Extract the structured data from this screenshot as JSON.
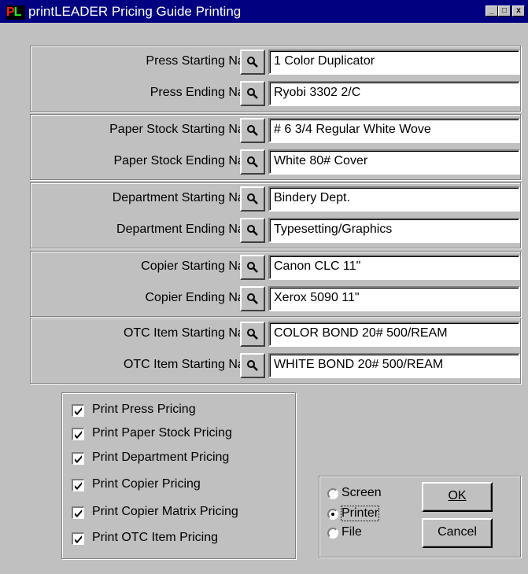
{
  "window": {
    "title": "printLEADER Pricing Guide Printing",
    "logo_text_p": "P",
    "logo_text_l": "L",
    "minimize_glyph": "_",
    "maximize_glyph": "□",
    "close_glyph": "x"
  },
  "groups": [
    {
      "rows": [
        {
          "label": "Press Starting Name",
          "value": "1 Color Duplicator"
        },
        {
          "label": "Press Ending Name",
          "value": "Ryobi 3302 2/C"
        }
      ]
    },
    {
      "rows": [
        {
          "label": "Paper Stock Starting Name",
          "value": "# 6 3/4 Regular White Wove"
        },
        {
          "label": "Paper Stock Ending Name",
          "value": "White 80# Cover"
        }
      ]
    },
    {
      "rows": [
        {
          "label": "Department Starting Name",
          "value": "Bindery Dept."
        },
        {
          "label": "Department Ending Name",
          "value": "Typesetting/Graphics"
        }
      ]
    },
    {
      "rows": [
        {
          "label": "Copier Starting Name",
          "value": "Canon CLC 11\""
        },
        {
          "label": "Copier Ending Name",
          "value": "Xerox 5090 11\""
        }
      ]
    },
    {
      "rows": [
        {
          "label": "OTC Item Starting Name",
          "value": "COLOR BOND 20# 500/REAM"
        },
        {
          "label": "OTC Item Starting Name",
          "value": "WHITE BOND 20# 500/REAM"
        }
      ]
    }
  ],
  "options": [
    {
      "label": "Print Press Pricing",
      "checked": true
    },
    {
      "label": "Print Paper Stock Pricing",
      "checked": true
    },
    {
      "label": "Print Department Pricing",
      "checked": true
    },
    {
      "label": "Print Copier Pricing",
      "checked": true
    },
    {
      "label": "Print Copier Matrix Pricing",
      "checked": true
    },
    {
      "label": "Print OTC Item Pricing",
      "checked": true
    }
  ],
  "output": {
    "choices": [
      "Screen",
      "Printer",
      "File"
    ],
    "selected": "Printer"
  },
  "buttons": {
    "ok_label": "OK",
    "cancel_label": "Cancel"
  },
  "icons": {
    "lookup": "magnifier-icon",
    "check": "checkmark-icon"
  }
}
